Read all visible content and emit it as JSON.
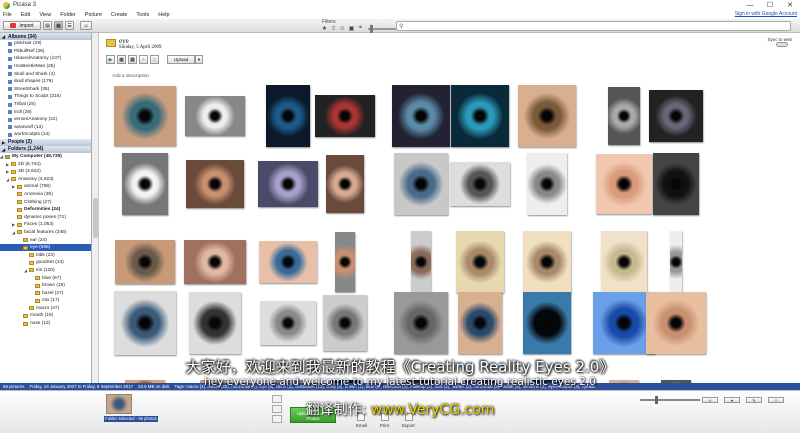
{
  "window": {
    "title": "Picasa 3",
    "sign_in": "Sign in with Google Account"
  },
  "menu": [
    "File",
    "Edit",
    "View",
    "Folder",
    "Picture",
    "Create",
    "Tools",
    "Help"
  ],
  "toolbar": {
    "import_label": "Import",
    "filters_label": "Filters"
  },
  "search": {
    "placeholder": ""
  },
  "sidebar": {
    "albums_header": "Albums (34)",
    "albums": [
      "pinkHair (29)",
      "PitbullRef (26)",
      "relaxedAnatomy (137)",
      "rmoBeetleMan (25)",
      "Skull and Shark (4)",
      "skull shapes (179)",
      "StreetShark (35)",
      "Things to Sculpt (216)",
      "Tribal (25)",
      "troll (28)",
      "venomAnatomy (22)",
      "wearwolf (13)",
      "workSculpts (14)"
    ],
    "people_header": "People (2)",
    "folders_header": "Folders (1,244)",
    "my_computer": "My Computer (48,739)",
    "folders": [
      {
        "label": "2D (8,744)",
        "indent": 1,
        "exp": "▶"
      },
      {
        "label": "3D (3,622)",
        "indent": 1,
        "exp": "▶"
      },
      {
        "label": "Anatomy (4,923)",
        "indent": 1,
        "exp": "◢"
      },
      {
        "label": "animal (768)",
        "indent": 2,
        "exp": "▶"
      },
      {
        "label": "Anorexia (36)",
        "indent": 2,
        "exp": ""
      },
      {
        "label": "Clothing (27)",
        "indent": 2,
        "exp": ""
      },
      {
        "label": "Deformities (24)",
        "indent": 2,
        "exp": "",
        "bold": true
      },
      {
        "label": "dynamic poses (71)",
        "indent": 2,
        "exp": ""
      },
      {
        "label": "Faces (1,053)",
        "indent": 2,
        "exp": "▶"
      },
      {
        "label": "facial features (346)",
        "indent": 2,
        "exp": "◢"
      },
      {
        "label": "ear (24)",
        "indent": 3,
        "exp": ""
      },
      {
        "label": "eye (566)",
        "indent": 3,
        "exp": "◢",
        "sel": true
      },
      {
        "label": "bibk (23)",
        "indent": 4,
        "exp": ""
      },
      {
        "label": "goodSet (13)",
        "indent": 4,
        "exp": ""
      },
      {
        "label": "iris (120)",
        "indent": 4,
        "exp": "◢"
      },
      {
        "label": "blue (57)",
        "indent": 5,
        "exp": ""
      },
      {
        "label": "brown (19)",
        "indent": 5,
        "exp": ""
      },
      {
        "label": "hazel (27)",
        "indent": 5,
        "exp": ""
      },
      {
        "label": "mix (17)",
        "indent": 5,
        "exp": ""
      },
      {
        "label": "macro (47)",
        "indent": 4,
        "exp": ""
      },
      {
        "label": "mouth (19)",
        "indent": 3,
        "exp": ""
      },
      {
        "label": "nose (12)",
        "indent": 3,
        "exp": ""
      }
    ]
  },
  "album": {
    "name": "eye",
    "date": "Sunday, 5 April 2009",
    "sync_label": "Sync to web",
    "upload_label": "Upload",
    "add_description": "Add a description"
  },
  "thumbs": [
    {
      "c": "#3a6a7a",
      "g": "#c99f80"
    },
    {
      "c": "#eee",
      "g": "#888"
    },
    {
      "c": "#1c5a8a",
      "g": "#0a1a2a"
    },
    {
      "c": "#a33",
      "g": "#222"
    },
    {
      "c": "#5a8aa8",
      "g": "#223"
    },
    {
      "c": "#2a9ab8",
      "g": "#0a2a3a"
    },
    {
      "c": "#7a5a3a",
      "g": "#d8b090"
    },
    {
      "c": "#aaa",
      "g": "#555"
    },
    {
      "c": "#667",
      "g": "#222"
    },
    {
      "c": "#f2f2f2",
      "g": "#777"
    },
    {
      "c": "#c89070",
      "g": "#6a4a3a"
    },
    {
      "c": "#a8a0c8",
      "g": "#4a4a6a"
    },
    {
      "c": "#d8a890",
      "g": "#6a4a3a"
    },
    {
      "c": "#4a6a8a",
      "g": "#c8c8c8"
    },
    {
      "c": "#555",
      "g": "#ddd"
    },
    {
      "c": "#888",
      "g": "#eee"
    },
    {
      "c": "#d89a7a",
      "g": "#f0c8b0"
    },
    {
      "c": "#111",
      "g": "#444"
    },
    {
      "c": "#6a5a4a",
      "g": "#c89a7a"
    },
    {
      "c": "#e0b8a0",
      "g": "#a07060"
    },
    {
      "c": "#3a6a9a",
      "g": "#e8c0a8"
    },
    {
      "c": "#c89070",
      "g": "#888"
    },
    {
      "c": "#8a6a5a",
      "g": "#ccc"
    },
    {
      "c": "#a88a6a",
      "g": "#e8d8b0"
    },
    {
      "c": "#a88a6a",
      "g": "#f0e0c0"
    },
    {
      "c": "#c8b890",
      "g": "#efe2c8"
    },
    {
      "c": "#999",
      "g": "#eee"
    },
    {
      "c": "#3a5a7a",
      "g": "#ddd"
    },
    {
      "c": "#333",
      "g": "#ddd"
    },
    {
      "c": "#888",
      "g": "#ddd"
    },
    {
      "c": "#777",
      "g": "#ccc"
    },
    {
      "c": "#666",
      "g": "#999"
    },
    {
      "c": "#2a4a6a",
      "g": "#d8b090"
    },
    {
      "c": "#05070a",
      "g": "#3a7aaa"
    },
    {
      "c": "#1a4aa8",
      "g": "#6aa0e8"
    },
    {
      "c": "#c89070",
      "g": "#e8c0a0"
    },
    {
      "c": "#5a4a2a",
      "g": "#e8a070"
    }
  ],
  "status": {
    "count": "65 pictures",
    "range": "Friday, 19 January 2007 to Friday, 8 September 2017",
    "size": "23.6 MB on disk",
    "tags": "Tags: macro (4), macro (22), horizontal (3), Eye (5), circle (1), illustration (13), Gray (6), brown (2), blue (9), reflection (2), makeup (2), look (2), lashes (2), horizontal (3), health (3), feminine (3), eyeshadows (3), eyelids"
  },
  "tray": {
    "hold_label": "Folder Selected - 65 photos",
    "upload_google": "Upload to Google Photos",
    "email": "Email",
    "print": "Print",
    "export": "Export"
  },
  "subtitles": {
    "cn": "大家好，欢迎来到我最新的教程《Creating Reality Eyes 2.0》",
    "en": "hey everyone and welcome to my latest tutorial creating realistic eyes 2.0",
    "site_prefix": "翻译制作: ",
    "site_url": "www.VeryCG.com"
  }
}
